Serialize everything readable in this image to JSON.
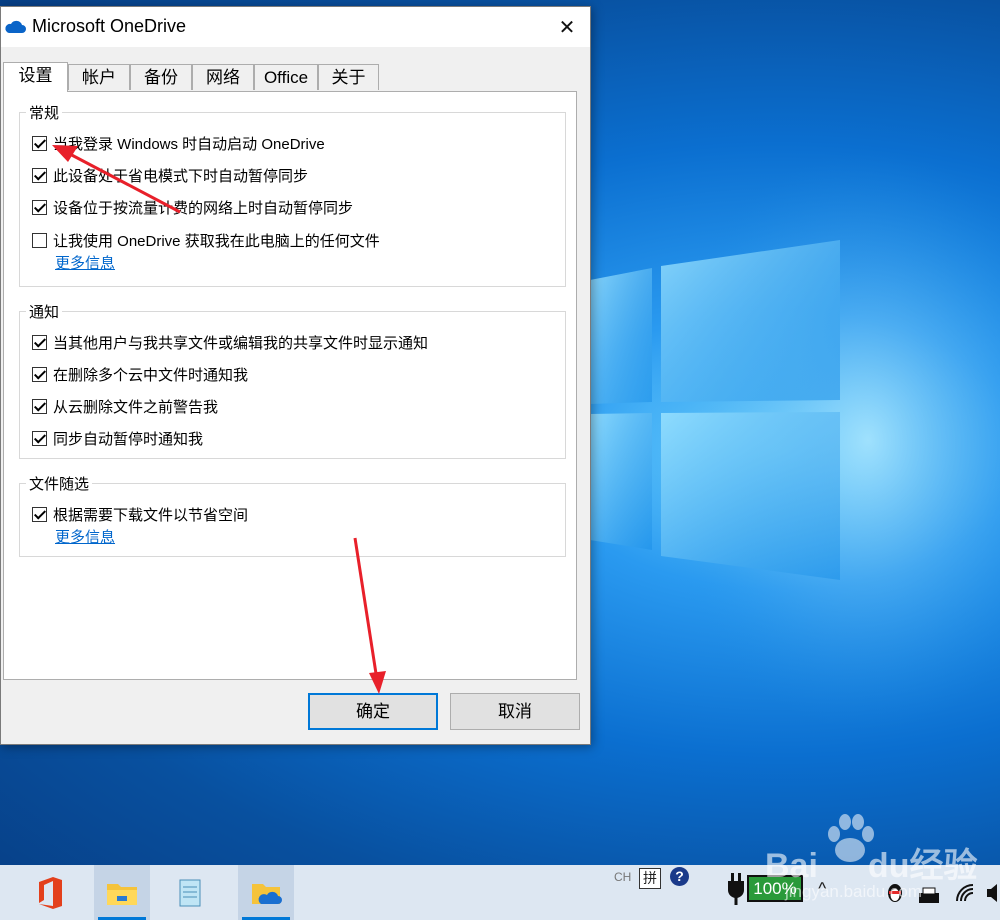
{
  "dialog": {
    "title": "Microsoft OneDrive",
    "close_glyph": "✕",
    "tabs": [
      {
        "label": "设置",
        "active": true
      },
      {
        "label": "帐户",
        "active": false
      },
      {
        "label": "备份",
        "active": false
      },
      {
        "label": "网络",
        "active": false
      },
      {
        "label": "Office",
        "active": false
      },
      {
        "label": "关于",
        "active": false
      }
    ],
    "general": {
      "title": "常规",
      "options": [
        {
          "label": "当我登录 Windows 时自动启动 OneDrive",
          "checked": true
        },
        {
          "label": "此设备处于省电模式下时自动暂停同步",
          "checked": true
        },
        {
          "label": "设备位于按流量计费的网络上时自动暂停同步",
          "checked": true
        },
        {
          "label": "让我使用 OneDrive 获取我在此电脑上的任何文件",
          "checked": false
        }
      ],
      "more_info": "更多信息"
    },
    "notifications": {
      "title": "通知",
      "options": [
        {
          "label": "当其他用户与我共享文件或编辑我的共享文件时显示通知",
          "checked": true
        },
        {
          "label": "在删除多个云中文件时通知我",
          "checked": true
        },
        {
          "label": "从云删除文件之前警告我",
          "checked": true
        },
        {
          "label": "同步自动暂停时通知我",
          "checked": true
        }
      ]
    },
    "files_on_demand": {
      "title": "文件随选",
      "options": [
        {
          "label": "根据需要下载文件以节省空间",
          "checked": true
        }
      ],
      "more_info": "更多信息"
    },
    "ok_label": "确定",
    "cancel_label": "取消"
  },
  "taskbar": {
    "apps": [
      "office-icon",
      "file-explorer-icon",
      "notepad-icon",
      "onedrive-folder-icon"
    ],
    "tray": {
      "ime_lang": "CH",
      "ime_mode": "拼",
      "help": "?",
      "battery": "100%",
      "chevron": "^"
    }
  },
  "watermark": {
    "brand": "Bai",
    "brand2": "du",
    "brand_cn": "经验",
    "url": "jingyan.baidu.com"
  },
  "colors": {
    "accent": "#0078d7",
    "link": "#0066cc",
    "annotation_arrow": "#e8202a"
  }
}
